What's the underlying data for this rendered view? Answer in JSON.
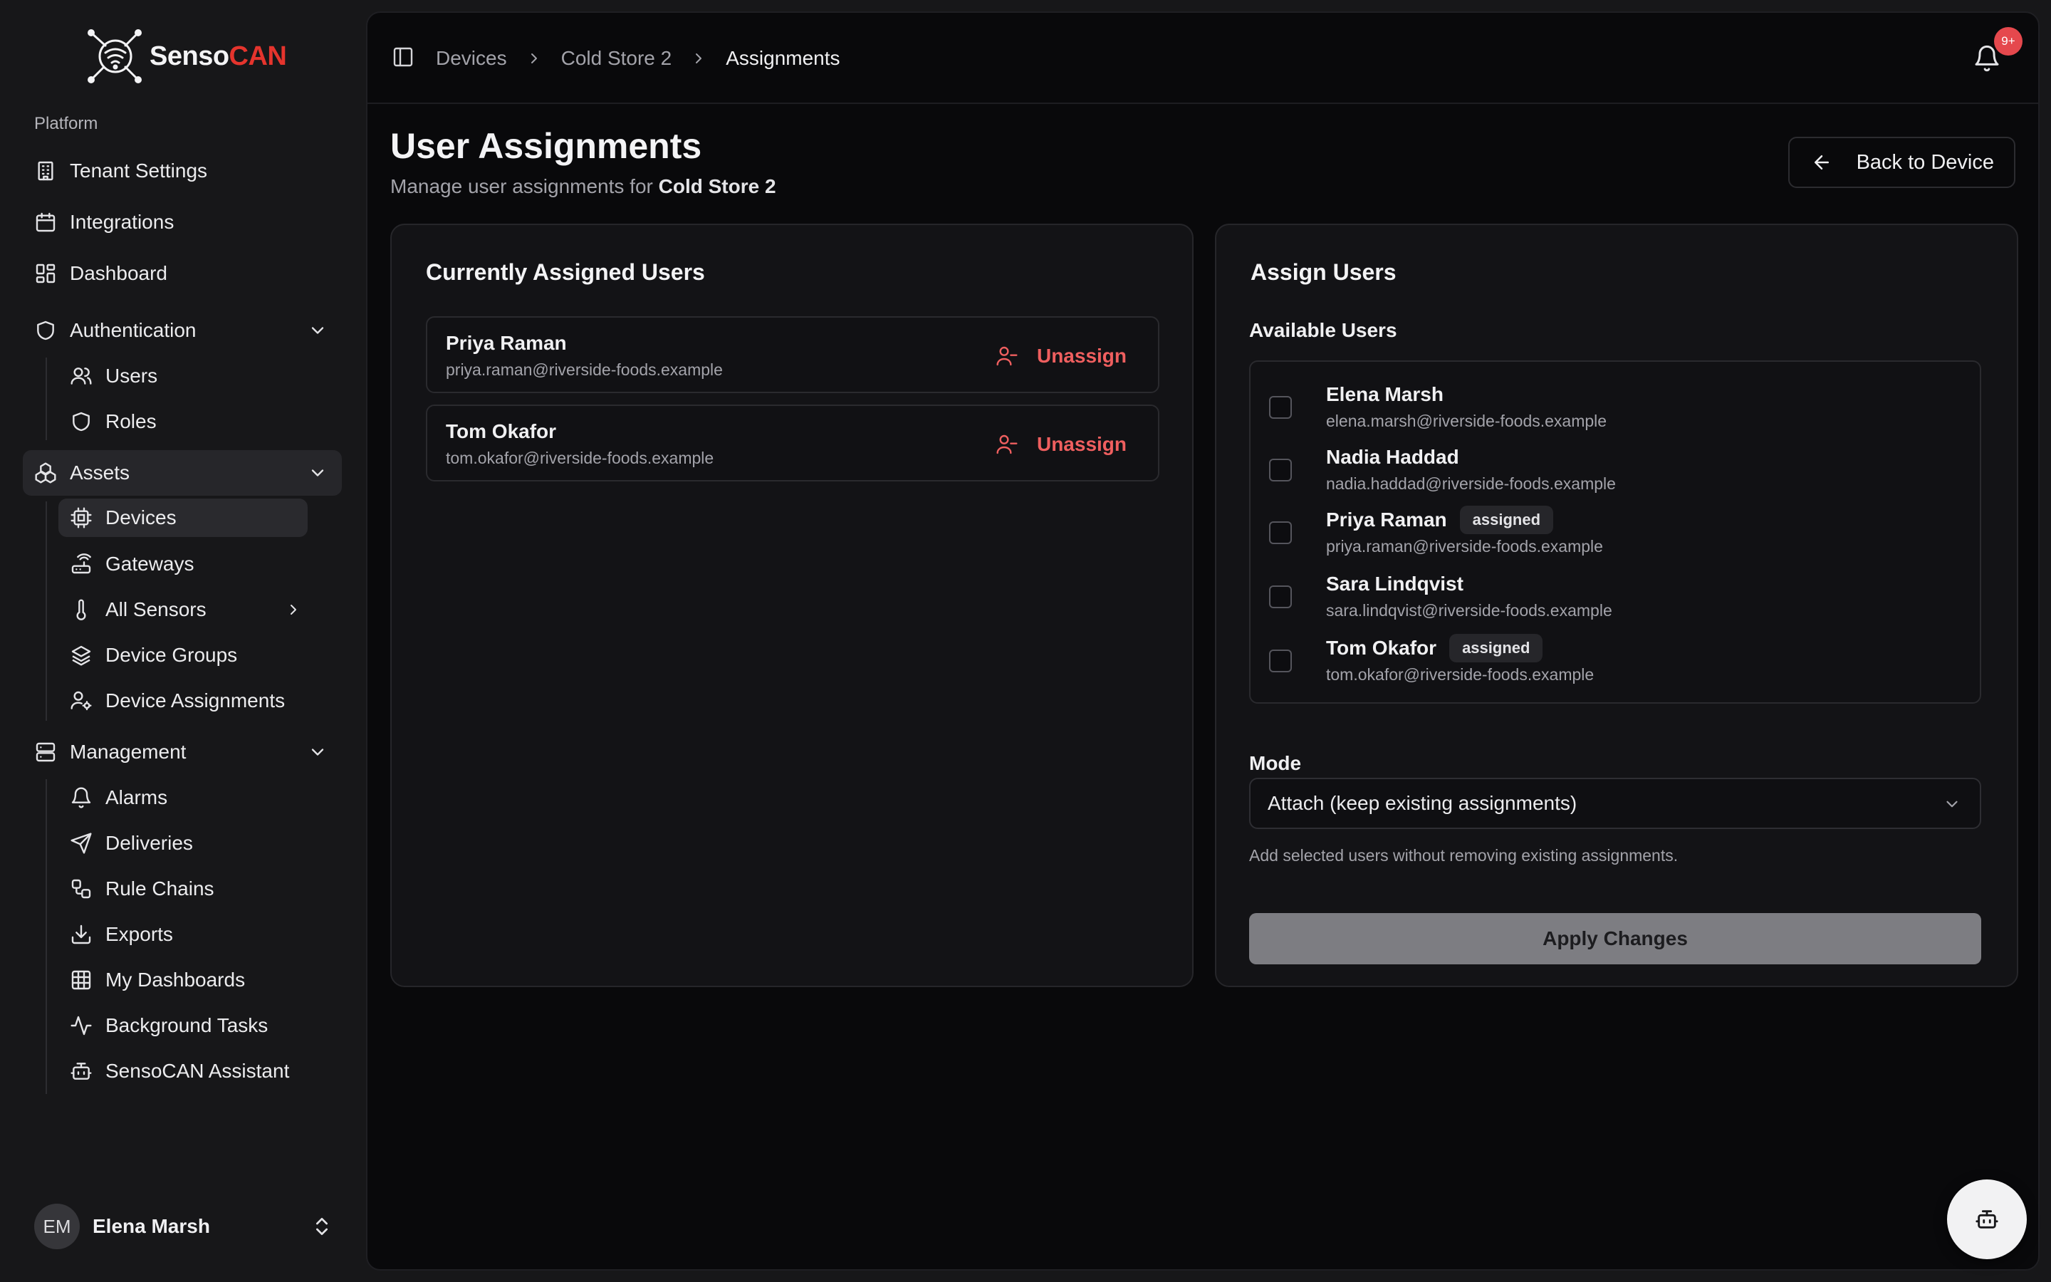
{
  "brand": {
    "name_prefix": "Senso",
    "name_accent": "CAN",
    "accent_color": "#e5342d"
  },
  "sidebar": {
    "section_label": "Platform",
    "items": {
      "tenant_settings": "Tenant Settings",
      "integrations": "Integrations",
      "dashboard": "Dashboard",
      "authentication": "Authentication",
      "users": "Users",
      "roles": "Roles",
      "assets": "Assets",
      "devices": "Devices",
      "gateways": "Gateways",
      "all_sensors": "All Sensors",
      "device_groups": "Device Groups",
      "device_assignments": "Device Assignments",
      "management": "Management",
      "alarms": "Alarms",
      "deliveries": "Deliveries",
      "rule_chains": "Rule Chains",
      "exports": "Exports",
      "my_dashboards": "My Dashboards",
      "background_tasks": "Background Tasks",
      "assistant": "SensoCAN Assistant"
    },
    "user": {
      "initials": "EM",
      "name": "Elena Marsh"
    }
  },
  "header": {
    "breadcrumbs": [
      "Devices",
      "Cold Store 2",
      "Assignments"
    ],
    "notifications_badge": "9+"
  },
  "page": {
    "title": "User Assignments",
    "subtitle_prefix": "Manage user assignments for",
    "device_name": "Cold Store 2",
    "back_button": "Back to Device"
  },
  "assigned": {
    "title": "Currently Assigned Users",
    "unassign_label": "Unassign",
    "users": [
      {
        "name": "Priya Raman",
        "email": "priya.raman@riverside-foods.example"
      },
      {
        "name": "Tom Okafor",
        "email": "tom.okafor@riverside-foods.example"
      }
    ]
  },
  "assign": {
    "title": "Assign Users",
    "available_label": "Available Users",
    "assigned_badge": "assigned",
    "users": [
      {
        "name": "Elena Marsh",
        "email": "elena.marsh@riverside-foods.example",
        "assigned": false,
        "checked": false
      },
      {
        "name": "Nadia Haddad",
        "email": "nadia.haddad@riverside-foods.example",
        "assigned": false,
        "checked": false
      },
      {
        "name": "Priya Raman",
        "email": "priya.raman@riverside-foods.example",
        "assigned": true,
        "checked": false
      },
      {
        "name": "Sara Lindqvist",
        "email": "sara.lindqvist@riverside-foods.example",
        "assigned": false,
        "checked": false
      },
      {
        "name": "Tom Okafor",
        "email": "tom.okafor@riverside-foods.example",
        "assigned": true,
        "checked": false
      }
    ],
    "mode_label": "Mode",
    "mode_value": "Attach (keep existing assignments)",
    "mode_hint": "Add selected users without removing existing assignments.",
    "apply_label": "Apply Changes"
  },
  "icons": {
    "tenant_settings": "building-icon",
    "integrations": "calendar-icon",
    "dashboard": "layout-grid-icon",
    "authentication": "shield-icon",
    "users": "users-icon",
    "roles": "shield-icon",
    "assets": "boxes-icon",
    "devices": "cpu-icon",
    "gateways": "router-icon",
    "all_sensors": "thermometer-icon",
    "device_groups": "layers-icon",
    "device_assignments": "user-cog-icon",
    "management": "server-icon",
    "alarms": "bell-icon",
    "deliveries": "send-icon",
    "rule_chains": "workflow-icon",
    "exports": "download-icon",
    "my_dashboards": "table-icon",
    "background_tasks": "activity-icon",
    "assistant": "bot-icon"
  }
}
